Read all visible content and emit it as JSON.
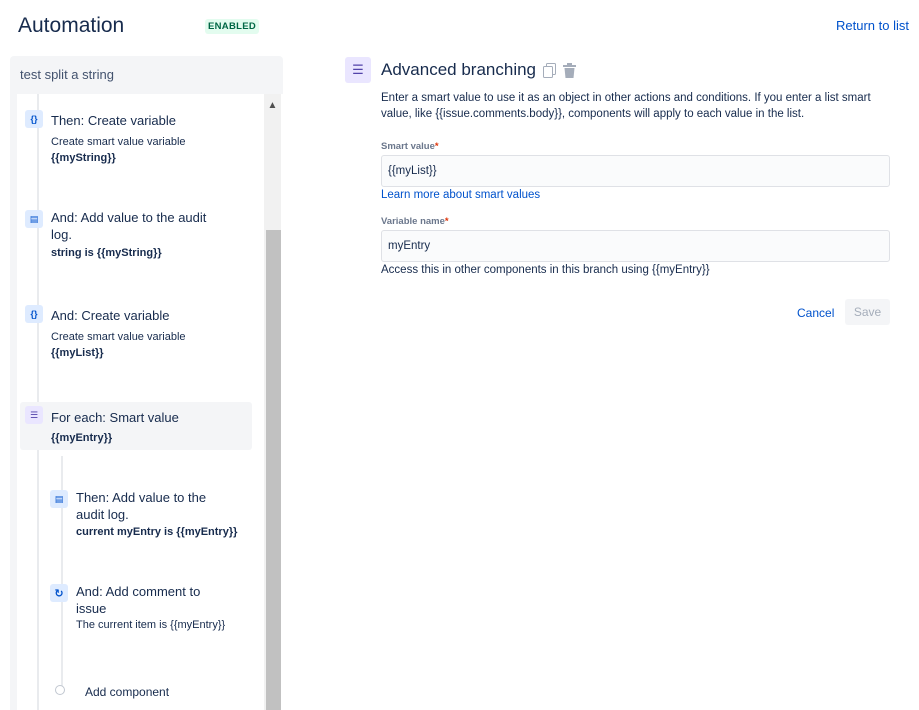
{
  "header": {
    "title": "Automation",
    "status": "ENABLED",
    "return_link": "Return to list"
  },
  "rule": {
    "name": "test split a string",
    "components": [
      {
        "icon": "variable-icon",
        "title": "Then: Create variable",
        "subtitle": "Create smart value variable",
        "detail": "{{myString}}"
      },
      {
        "icon": "audit-log-icon",
        "title_line1": "And: Add value to the audit",
        "title_line2": "log.",
        "detail": "string is {{myString}}"
      },
      {
        "icon": "variable-icon",
        "title": "And: Create variable",
        "subtitle": "Create smart value variable",
        "detail": "{{myList}}"
      },
      {
        "icon": "branch-list-icon",
        "title": "For each: Smart value",
        "detail": "{{myEntry}}"
      },
      {
        "icon": "audit-log-icon",
        "title_line1": "Then: Add value to the",
        "title_line2": "audit log.",
        "detail": "current myEntry is {{myEntry}}"
      },
      {
        "icon": "comment-icon",
        "title_line1": "And: Add comment to",
        "title_line2": "issue",
        "subtitle": "The current item is {{myEntry}}"
      }
    ],
    "add_component": "Add component"
  },
  "editor": {
    "title": "Advanced branching",
    "description": "Enter a smart value to use it as an object in other actions and conditions. If you enter a list smart value, like {{issue.comments.body}}, components will apply to each value in the list.",
    "smart_value_label": "Smart value",
    "smart_value": "{{myList}}",
    "learn_more": "Learn more about smart values",
    "variable_name_label": "Variable name",
    "variable_name": "myEntry",
    "helper": "Access this in other components in this branch using {{myEntry}}",
    "required_mark": "*",
    "cancel": "Cancel",
    "save": "Save"
  },
  "colors": {
    "accent": "#0052cc",
    "enabled_bg": "#e3fcef",
    "enabled_text": "#006644",
    "branch_icon_bg": "#eae6ff"
  }
}
